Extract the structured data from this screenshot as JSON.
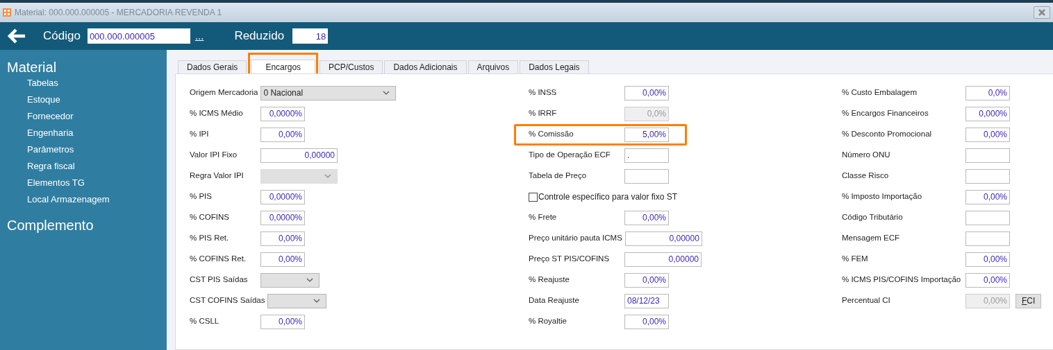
{
  "window": {
    "title": "Material: 000.000.000005 - MERCADORIA REVENDA 1"
  },
  "header": {
    "code_label": "Código",
    "code_value": "000.000.000005",
    "lookup": "...",
    "reduced_label": "Reduzido",
    "reduced_value": "18"
  },
  "sidebar": {
    "sections": [
      {
        "title": "Material",
        "items": [
          "Tabelas",
          "Estoque",
          "Fornecedor",
          "Engenharia",
          "Parâmetros",
          "Regra fiscal",
          "Elementos TG",
          "Local Armazenagem"
        ]
      },
      {
        "title": "Complemento"
      }
    ]
  },
  "tabs": [
    {
      "label": "Dados Gerais",
      "selected": false,
      "highlighted": false
    },
    {
      "label": "Encargos",
      "selected": true,
      "highlighted": true
    },
    {
      "label": "PCP/Custos",
      "selected": false,
      "highlighted": false
    },
    {
      "label": "Dados Adicionais",
      "selected": false,
      "highlighted": false
    },
    {
      "label": "Arquivos",
      "selected": false,
      "highlighted": false
    },
    {
      "label": "Dados Legais",
      "selected": false,
      "highlighted": false
    }
  ],
  "columns": [
    [
      {
        "kind": "wide_select",
        "label": "Origem Mercadoria",
        "value": "0 Nacional",
        "disabled": false
      },
      {
        "kind": "short_input",
        "label": "% ICMS Médio",
        "value": "0,0000%",
        "disabled": false
      },
      {
        "kind": "short_input",
        "label": "% IPI",
        "value": "0,00%",
        "disabled": false
      },
      {
        "kind": "long_input",
        "label": "Valor IPI Fixo",
        "value": "0,00000",
        "disabled": false
      },
      {
        "kind": "long_select",
        "label": "Regra Valor IPI",
        "disabled": true
      },
      {
        "kind": "short_input",
        "label": "% PIS",
        "value": "0,0000%",
        "disabled": false
      },
      {
        "kind": "short_input",
        "label": "% COFINS",
        "value": "0,0000%",
        "disabled": false
      },
      {
        "kind": "short_input",
        "label": "% PIS Ret.",
        "value": "0,00%",
        "disabled": false
      },
      {
        "kind": "short_input",
        "label": "% COFINS Ret.",
        "value": "0,00%",
        "disabled": false
      },
      {
        "kind": "short_select",
        "label": "CST PIS Saídas",
        "disabled": false
      },
      {
        "kind": "short_select",
        "label": "CST COFINS Saídas",
        "disabled": false
      },
      {
        "kind": "short_input",
        "label": "% CSLL",
        "value": "0,00%",
        "disabled": false
      }
    ],
    [
      {
        "kind": "short_input",
        "label": "% INSS",
        "value": "0,00%",
        "disabled": false
      },
      {
        "kind": "short_input",
        "label": "% IRRF",
        "value": "0,0%",
        "disabled": true
      },
      {
        "kind": "short_input",
        "label": "% Comissão",
        "value": "5,00%",
        "disabled": false,
        "highlighted": true
      },
      {
        "kind": "text_input",
        "label": "Tipo de Operação ECF",
        "value": ".",
        "disabled": false
      },
      {
        "kind": "short_input",
        "label": "Tabela de Preço",
        "disabled": false
      },
      {
        "kind": "checkbox",
        "label": "Controle específico para valor fixo ST",
        "checked": false
      },
      {
        "kind": "short_input",
        "label": "% Frete",
        "value": "0,00%",
        "disabled": false
      },
      {
        "kind": "long_input",
        "label": "Preço unitário pauta ICMS",
        "value": "0,00000",
        "disabled": false
      },
      {
        "kind": "long_input",
        "label": "Preço ST PIS/COFINS",
        "value": "0,00000",
        "disabled": false
      },
      {
        "kind": "short_input",
        "label": "% Reajuste",
        "value": "0,00%",
        "disabled": false
      },
      {
        "kind": "text_input",
        "label": "Data Reajuste",
        "value": "08/12/23",
        "disabled": false
      },
      {
        "kind": "short_input",
        "label": "% Royaltie",
        "value": "0,00%",
        "disabled": false
      }
    ],
    [
      {
        "kind": "short_input",
        "label": "% Custo Embalagem",
        "value": "0,0%",
        "disabled": false
      },
      {
        "kind": "short_input",
        "label": "% Encargos Financeiros",
        "value": "0,000%",
        "disabled": false
      },
      {
        "kind": "short_input",
        "label": "% Desconto Promocional",
        "value": "0,00%",
        "disabled": false
      },
      {
        "kind": "short_input",
        "label": "Número ONU",
        "disabled": false
      },
      {
        "kind": "short_input",
        "label": "Classe Risco",
        "disabled": false
      },
      {
        "kind": "short_input",
        "label": "% Imposto Importação",
        "value": "0,00%",
        "disabled": false
      },
      {
        "kind": "short_input",
        "label": "Código Tributário",
        "disabled": false
      },
      {
        "kind": "short_input",
        "label": "Mensagem ECF",
        "disabled": false
      },
      {
        "kind": "short_input",
        "label": "% FEM",
        "value": "0,00%",
        "disabled": false
      },
      {
        "kind": "short_input",
        "label": "% ICMS PIS/COFINS Importação",
        "value": "0,00%",
        "disabled": false
      },
      {
        "kind": "short_input",
        "label": "Percentual CI",
        "value": "0,00%",
        "disabled": true,
        "button": "FCI"
      }
    ]
  ]
}
